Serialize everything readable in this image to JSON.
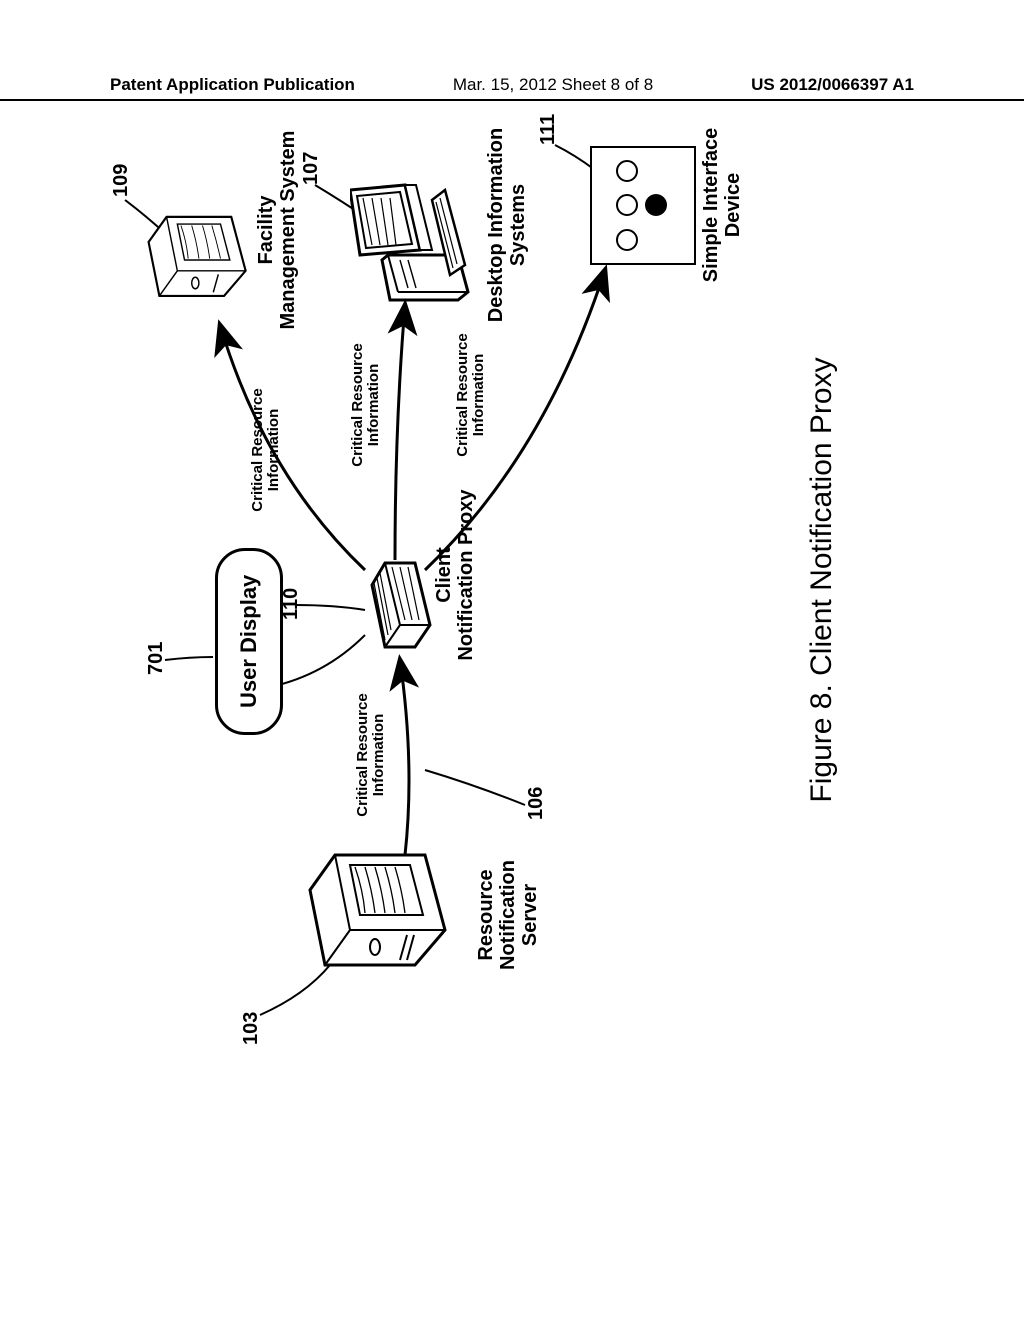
{
  "header": {
    "left": "Patent Application Publication",
    "middle": "Mar. 15, 2012  Sheet 8 of 8",
    "right": "US 2012/0066397 A1"
  },
  "figure": {
    "title": "Figure 8.  Client Notification Proxy"
  },
  "nodes": {
    "user_display": {
      "label": "User Display",
      "ref": "701"
    },
    "resource_notification_server": {
      "label_l1": "Resource",
      "label_l2": "Notification",
      "label_l3": "Server",
      "ref": "103"
    },
    "client_notification_proxy": {
      "label_l1": "Client",
      "label_l2": "Notification Proxy",
      "ref": "110"
    },
    "facility_management_system": {
      "label_l1": "Facility",
      "label_l2": "Management System",
      "ref": "109"
    },
    "desktop_information_systems": {
      "label_l1": "Desktop Information",
      "label_l2": "Systems",
      "ref": "107"
    },
    "simple_interface_device": {
      "label_l1": "Simple Interface",
      "label_l2": "Device",
      "ref": "111"
    }
  },
  "edges": {
    "cri1": {
      "l1": "Critical Resource",
      "l2": "Information",
      "ref": "106"
    },
    "cri2": {
      "l1": "Critical Resource",
      "l2": "Information"
    },
    "cri3": {
      "l1": "Critical Resource",
      "l2": "Information"
    },
    "cri4": {
      "l1": "Critical Resource",
      "l2": "Information"
    }
  }
}
